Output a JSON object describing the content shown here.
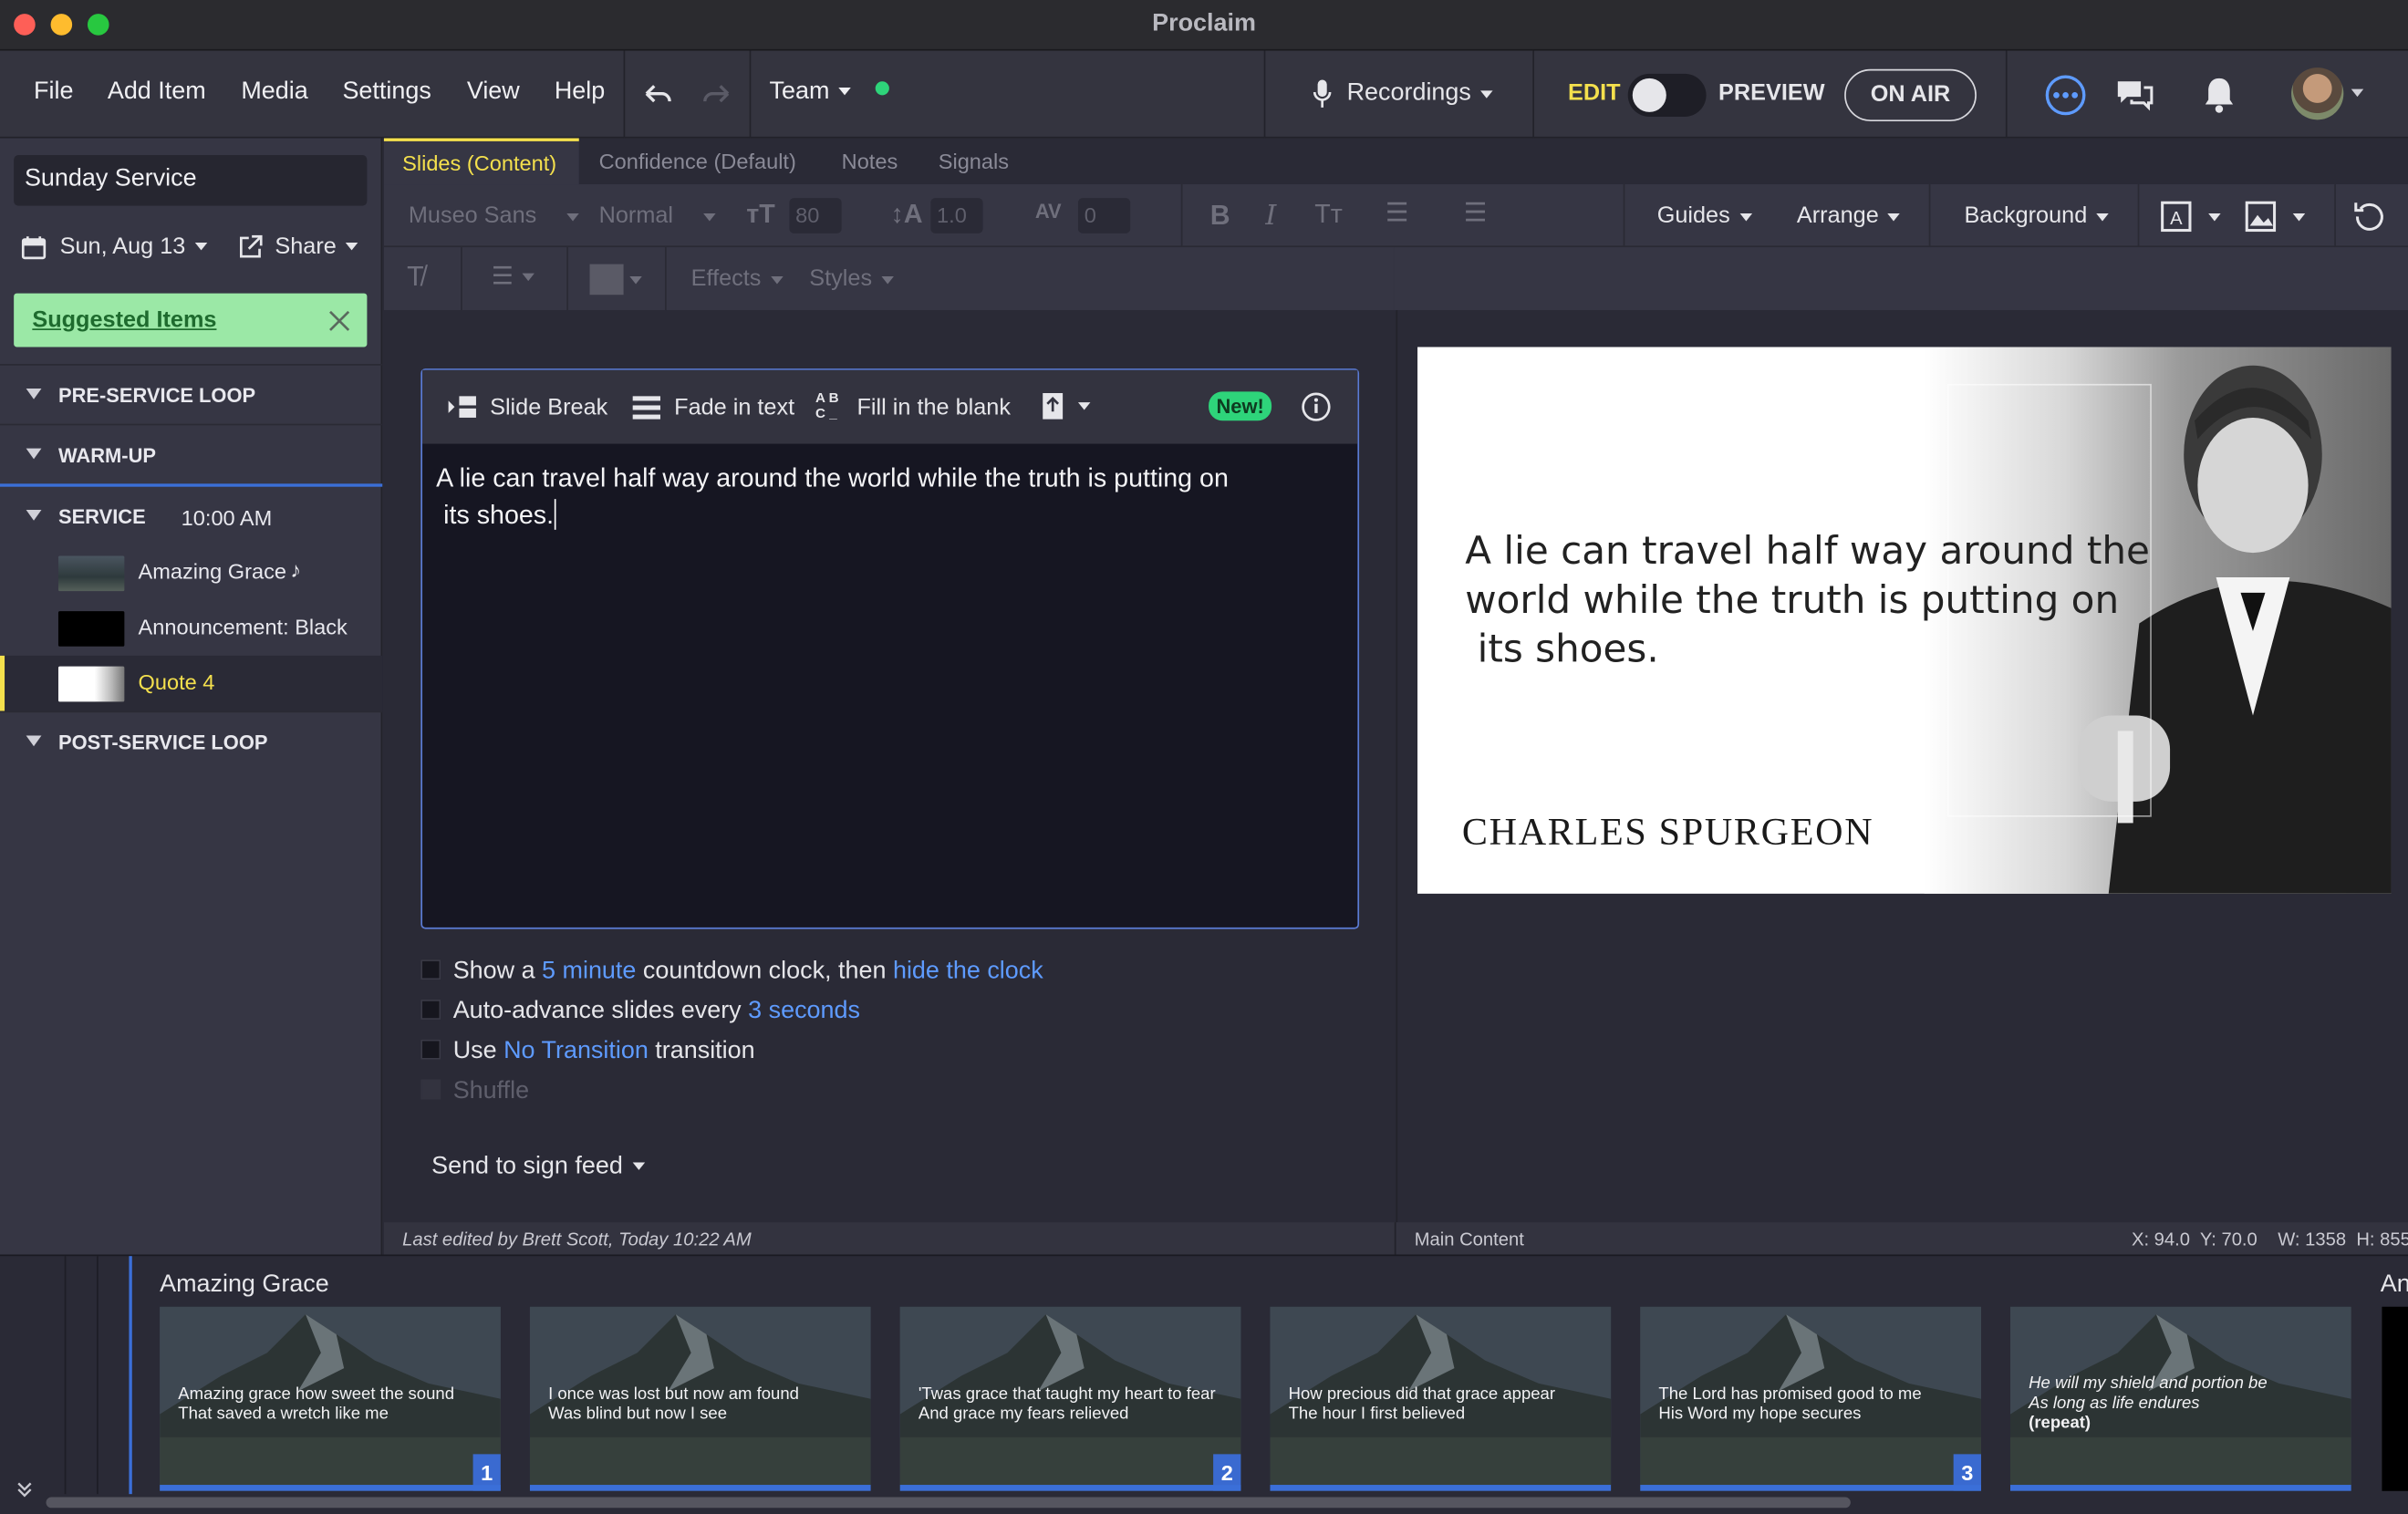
{
  "window": {
    "title": "Proclaim"
  },
  "menu": {
    "items": [
      "File",
      "Add Item",
      "Media",
      "Settings",
      "View",
      "Help"
    ],
    "team_label": "Team",
    "recordings_label": "Recordings",
    "edit_label": "EDIT",
    "preview_label": "PREVIEW",
    "on_air_label": "ON AIR"
  },
  "sidebar": {
    "service_name": "Sunday Service",
    "date": "Sun, Aug 13",
    "share_label": "Share",
    "suggested_label": "Suggested Items",
    "sections": {
      "pre_service": "PRE-SERVICE LOOP",
      "warm_up": "WARM-UP",
      "service": "SERVICE",
      "service_time": "10:00 AM",
      "post_service": "POST-SERVICE LOOP"
    },
    "items": [
      {
        "label": "Amazing Grace",
        "icon": "music-note-icon"
      },
      {
        "label": "Announcement: Black"
      },
      {
        "label": "Quote 4",
        "selected": true
      }
    ]
  },
  "tabs": [
    "Slides (Content)",
    "Confidence (Default)",
    "Notes",
    "Signals"
  ],
  "format": {
    "font": "Museo Sans",
    "weight": "Normal",
    "size": "80",
    "line_height": "1.0",
    "spacing": "0",
    "guides": "Guides",
    "arrange": "Arrange",
    "background": "Background",
    "effects": "Effects",
    "styles": "Styles"
  },
  "editor": {
    "slide_break": "Slide Break",
    "fade_in": "Fade in text",
    "fill_blank": "Fill in the blank",
    "new_badge": "New!",
    "text_line1": "A lie can travel half way around the world while the truth is putting on",
    "text_line2": " its shoes."
  },
  "options": {
    "countdown_pre": "Show a",
    "countdown_link": "5 minute",
    "countdown_mid": "countdown clock, then",
    "countdown_link2": "hide the clock",
    "advance_pre": "Auto-advance slides every",
    "advance_link": "3 seconds",
    "transition_pre": "Use",
    "transition_link": "No Transition",
    "transition_post": "transition",
    "shuffle": "Shuffle",
    "send_feed": "Send to sign feed"
  },
  "preview": {
    "quote_line1": "A lie can travel half way around the",
    "quote_line2": "world while the truth is putting on",
    "quote_line3": " its shoes.",
    "author": "CHARLES SPURGEON"
  },
  "status": {
    "last_edited": "Last edited by Brett Scott, Today 10:22 AM",
    "layer": "Main Content",
    "coords": "X: 94.0  Y: 70.0    W: 1358  H: 855"
  },
  "filmstrip": {
    "title": "Amazing Grace",
    "next_title": "An",
    "slides": [
      {
        "line1": "Amazing grace how sweet the sound",
        "line2": "That saved a wretch like me",
        "num": "1"
      },
      {
        "line1": "I once was lost but now am found",
        "line2": "Was blind but now I see",
        "num": ""
      },
      {
        "line1": "'Twas grace that taught my heart to fear",
        "line2": "And grace my fears relieved",
        "num": "2"
      },
      {
        "line1": "How precious did that grace appear",
        "line2": "The hour I first believed",
        "num": ""
      },
      {
        "line1": "The Lord has promised good to me",
        "line2": "His Word my hope secures",
        "num": "3"
      },
      {
        "line1": "He will my shield and portion be",
        "line2": "As long as life endures",
        "line3": "(repeat)",
        "num": ""
      }
    ]
  },
  "colors": {
    "accent": "#5e9bff",
    "active_yellow": "#f4e04d",
    "suggested_bg": "#9be8a6",
    "online_dot": "#2ed47a"
  }
}
